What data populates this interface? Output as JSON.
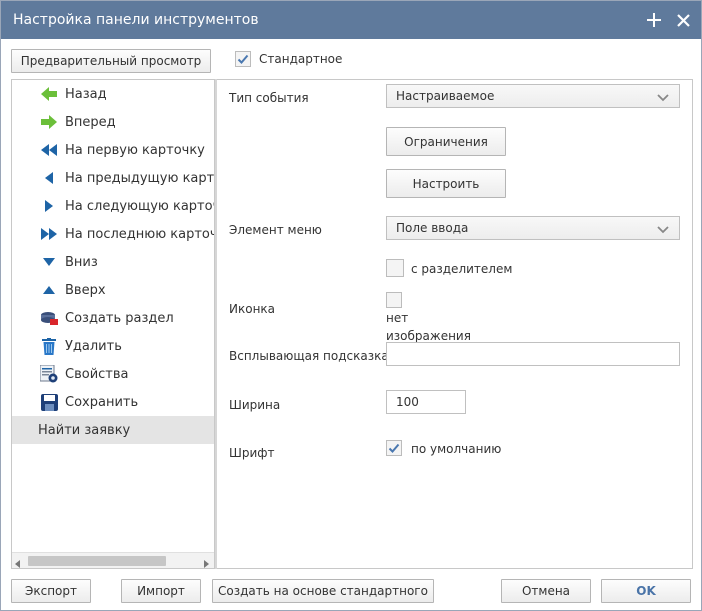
{
  "window": {
    "title": "Настройка панели инструментов"
  },
  "top": {
    "preview_button": "Предварительный просмотр",
    "standard_label": "Стандартное",
    "standard_checked": true
  },
  "list": {
    "items": [
      {
        "label": "Назад",
        "icon": "arrow-left-icon"
      },
      {
        "label": "Вперед",
        "icon": "arrow-right-icon"
      },
      {
        "label": "На первую карточку",
        "icon": "first-icon"
      },
      {
        "label": "На предыдущую карточку",
        "icon": "prev-icon"
      },
      {
        "label": "На следующую карточку",
        "icon": "next-icon"
      },
      {
        "label": "На последнюю карточку",
        "icon": "last-icon"
      },
      {
        "label": "Вниз",
        "icon": "down-icon"
      },
      {
        "label": "Вверх",
        "icon": "up-icon"
      },
      {
        "label": "Создать раздел",
        "icon": "create-section-icon"
      },
      {
        "label": "Удалить",
        "icon": "trash-icon"
      },
      {
        "label": "Свойства",
        "icon": "properties-icon"
      },
      {
        "label": "Сохранить",
        "icon": "save-icon"
      },
      {
        "label": "Найти заявку",
        "icon": ""
      }
    ],
    "selected_index": 12
  },
  "form": {
    "event_type_label": "Тип события",
    "event_type_value": "Настраиваемое",
    "restrictions_button": "Ограничения",
    "configure_button": "Настроить",
    "menu_item_label": "Элемент меню",
    "menu_item_value": "Поле ввода",
    "separator_label": "с разделителем",
    "separator_checked": false,
    "icon_label": "Иконка",
    "no_image_line1": "нет",
    "no_image_line2": "изображения",
    "tooltip_label": "Всплывающая подсказка",
    "tooltip_value": "",
    "width_label": "Ширина",
    "width_value": "100",
    "font_label": "Шрифт",
    "font_default_label": "по умолчанию",
    "font_default_checked": true
  },
  "footer": {
    "export_button": "Экспорт",
    "import_button": "Импорт",
    "create_from_standard_button": "Создать на основе стандартного",
    "cancel_button": "Отмена",
    "ok_button": "OK"
  },
  "colors": {
    "titlebar": "#5f7a9c",
    "green_arrow": "#6bbf3a",
    "blue_nav": "#1e64a6",
    "ok_text": "#4a74a8",
    "check": "#4a78b0"
  }
}
